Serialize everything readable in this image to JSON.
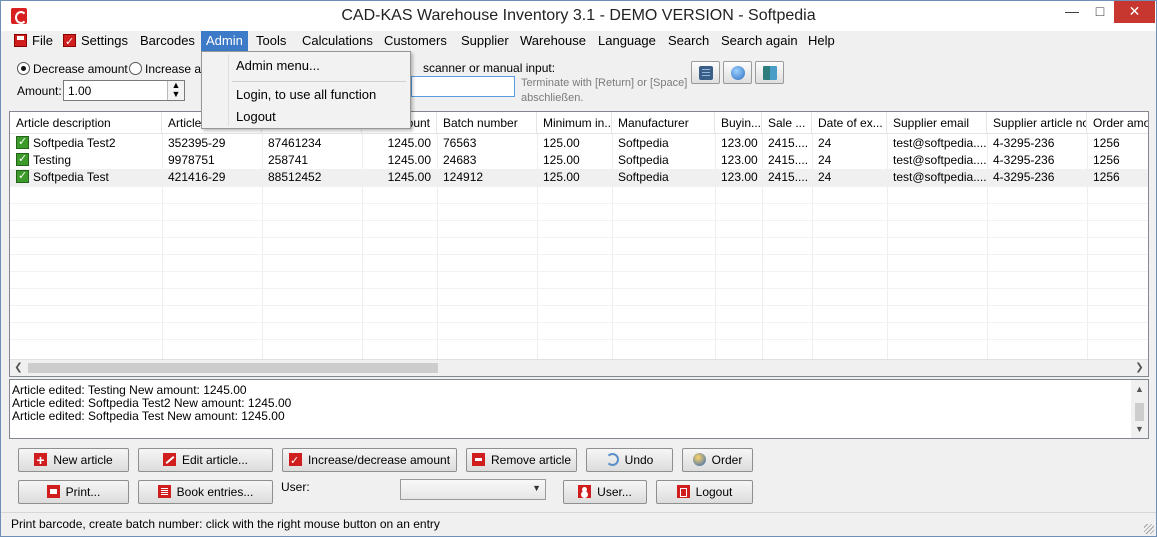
{
  "window": {
    "title": "CAD-KAS Warehouse Inventory 3.1 - DEMO VERSION - Softpedia"
  },
  "menu": {
    "file": "File",
    "settings": "Settings",
    "barcodes": "Barcodes",
    "admin": "Admin",
    "tools": "Tools",
    "calculations": "Calculations",
    "customers": "Customers",
    "supplier": "Supplier",
    "warehouse": "Warehouse",
    "language": "Language",
    "search": "Search",
    "search_again": "Search again",
    "help": "Help"
  },
  "admin_menu": {
    "admin_menu": "Admin menu...",
    "login": "Login, to use all function",
    "logout": "Logout"
  },
  "toolbar": {
    "decrease_label": "Decrease amount",
    "increase_label": "Increase am",
    "mode_selected": "Decrease amount",
    "amount_label": "Amount:",
    "amount_value": "1.00",
    "scanner_label": "scanner or manual input:",
    "scanner_value": "",
    "terminate_hint": "Terminate with [Return] or [Space] abschließen."
  },
  "grid": {
    "columns": [
      "Article description",
      "Article n",
      "",
      "Amount",
      "Batch number",
      "Minimum in...",
      "Manufacturer",
      "Buyin...",
      "Sale ...",
      "Date of ex...",
      "Supplier email",
      "Supplier article no.",
      "Order amou"
    ],
    "rows": [
      [
        "Softpedia Test2",
        "352395-29",
        "87461234",
        "1245.00",
        "76563",
        "125.00",
        "Softpedia",
        "123.00",
        "2415....",
        "24",
        "test@softpedia....",
        "4-3295-236",
        "1256"
      ],
      [
        "Testing",
        "9978751",
        "258741",
        "1245.00",
        "24683",
        "125.00",
        "Softpedia",
        "123.00",
        "2415....",
        "24",
        "test@softpedia....",
        "4-3295-236",
        "1256"
      ],
      [
        "Softpedia Test",
        "421416-29",
        "88512452",
        "1245.00",
        "124912",
        "125.00",
        "Softpedia",
        "123.00",
        "2415....",
        "24",
        "test@softpedia....",
        "4-3295-236",
        "1256"
      ]
    ],
    "selected_row": 2
  },
  "log": [
    "Article edited: Testing New amount: 1245.00",
    "Article edited: Softpedia Test2 New amount: 1245.00",
    "Article edited: Softpedia Test New amount: 1245.00"
  ],
  "buttons": {
    "new_article": "New article",
    "edit_article": "Edit article...",
    "increase_decrease": "Increase/decrease amount",
    "remove_article": "Remove article",
    "undo": "Undo",
    "order": "Order",
    "print": "Print...",
    "book_entries": "Book entries...",
    "user": "User...",
    "logout": "Logout"
  },
  "user": {
    "label": "User:",
    "selected": ""
  },
  "status": {
    "text": "Print barcode, create batch number: click with the right mouse button on an entry"
  },
  "colors": {
    "menu_highlight": "#3d7ac7",
    "close_button": "#c7372f",
    "brand_red": "#d01e1e",
    "check_green": "#3b9a2a"
  }
}
